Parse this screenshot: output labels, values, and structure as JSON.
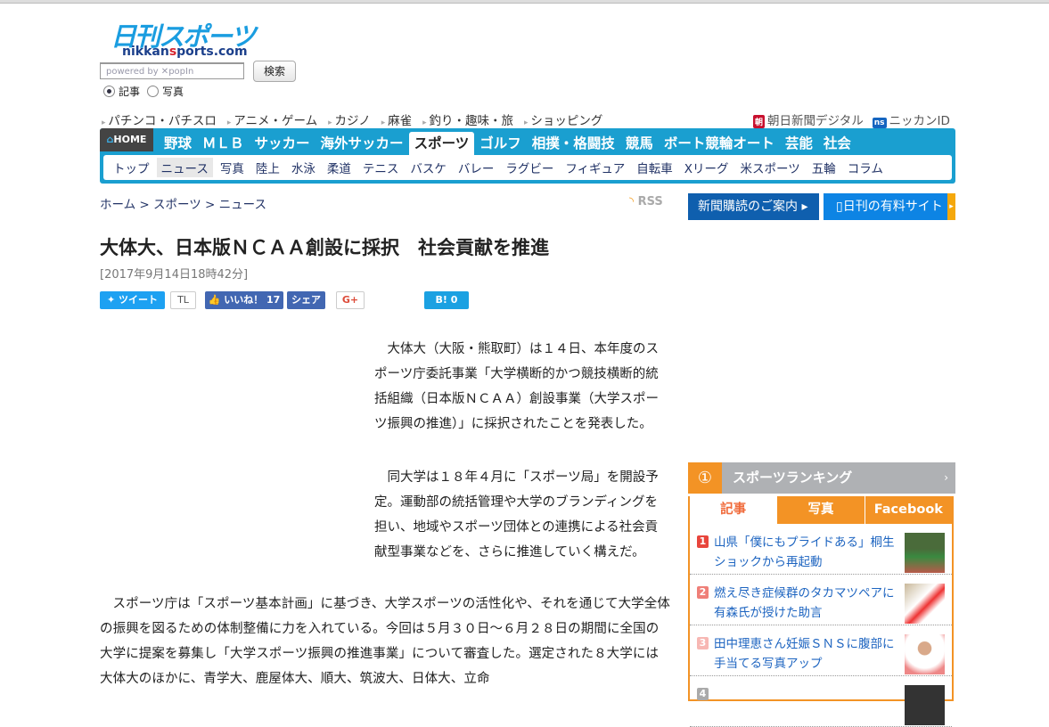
{
  "header": {
    "logo_jp": "日刊スポーツ",
    "logo_en_a": "nikkan",
    "logo_en_s": "s",
    "logo_en_b": "ports.com",
    "search_placeholder": "powered by ✕popIn",
    "search_button": "検索",
    "radio_article": "記事",
    "radio_photo": "写真"
  },
  "sublinks": [
    "パチンコ・パチスロ",
    "アニメ・ゲーム",
    "カジノ",
    "麻雀",
    "釣り・趣味・旅",
    "ショッピング"
  ],
  "right_links": [
    {
      "badge": "朝",
      "label": "朝日新聞デジタル",
      "color": "#c8102e"
    },
    {
      "badge": "ns",
      "label": "ニッカンID",
      "color": "#1565c0"
    }
  ],
  "nav": {
    "home": "HOME",
    "main": [
      "野球",
      "ＭＬＢ",
      "サッカー",
      "海外サッカー",
      "スポーツ",
      "ゴルフ",
      "相撲・格闘技",
      "競馬",
      "ボート競輪オート",
      "芸能",
      "社会"
    ],
    "active_main": "スポーツ",
    "sub": [
      "トップ",
      "ニュース",
      "写真",
      "陸上",
      "水泳",
      "柔道",
      "テニス",
      "バスケ",
      "バレー",
      "ラグビー",
      "フィギュア",
      "自転車",
      "Xリーグ",
      "米スポーツ",
      "五輪",
      "コラム"
    ],
    "active_sub": "ニュース"
  },
  "breadcrumb": "ホーム > スポーツ > ニュース",
  "rss": "RSS",
  "promo": {
    "subscribe": "新聞購読のご案内 ▸",
    "paid_site": "日刊の有料サイト"
  },
  "article": {
    "title": "大体大、日本版ＮＣＡＡ創設に採択　社会貢献を推進",
    "date": "[2017年9月14日18時42分]",
    "share": {
      "tweet": "ツイート",
      "tl": "TL",
      "like": "いいね！ 17",
      "fb_share": "シェア",
      "gplus": "G+",
      "hatena": "B! 0"
    },
    "paragraphs": [
      "大体大（大阪・熊取町）は１４日、本年度のスポーツ庁委託事業「大学横断的かつ競技横断的統括組織（日本版ＮＣＡＡ）創設事業（大学スポーツ振興の推進）」に採択されたことを発表した。",
      "同大学は１８年４月に「スポーツ局」を開設予定。運動部の統括管理や大学のブランディングを担い、地域やスポーツ団体との連携による社会貢献型事業などを、さらに推進していく構えだ。",
      "スポーツ庁は「スポーツ基本計画」に基づき、大学スポーツの活性化や、それを通じて大学全体の振興を図るための体制整備に力を入れている。今回は５月３０日〜６月２８日の期間に全国の大学に提案を募集し「大学スポーツ振興の推進事業」について審査した。選定された８大学には大体大のほかに、青学大、鹿屋体大、順大、筑波大、日体大、立命"
    ]
  },
  "ranking": {
    "title": "スポーツランキング",
    "tabs": [
      "記事",
      "写真",
      "Facebook"
    ],
    "active_tab": "記事",
    "items": [
      {
        "rank": "1",
        "text": "山県「僕にもプライドある」桐生ショックから再起動",
        "color": "#e8453c"
      },
      {
        "rank": "2",
        "text": "燃え尽き症候群のタカマツペアに有森氏が授けた助言",
        "color": "#ef7f78"
      },
      {
        "rank": "3",
        "text": "田中理恵さん妊娠ＳＮＳに腹部に手当てる写真アップ",
        "color": "#f7b7b3"
      },
      {
        "rank": "4",
        "text": "",
        "color": "#aaaaaa"
      }
    ]
  }
}
